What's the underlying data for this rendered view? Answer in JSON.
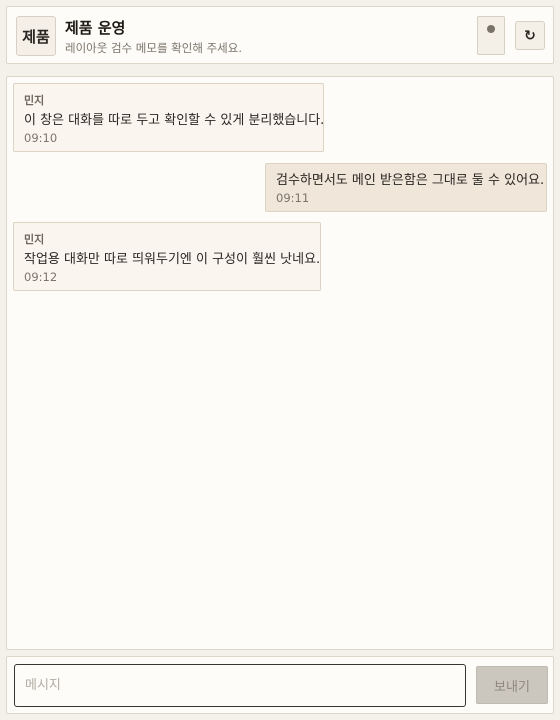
{
  "header": {
    "avatar_text": "제품",
    "title": "제품 운영",
    "subtitle": "레이아웃 검수 메모를 확인해 주세요.",
    "refresh_icon": "↻"
  },
  "messages": [
    {
      "direction": "in",
      "sender": "민지",
      "text": "이 창은 대화를 따로 두고 확인할 수 있게 분리했습니다.",
      "time": "09:10"
    },
    {
      "direction": "out",
      "sender": "",
      "text": "검수하면서도 메인 받은함은 그대로 둘 수 있어요.",
      "time": "09:11"
    },
    {
      "direction": "in",
      "sender": "민지",
      "text": "작업용 대화만 따로 띄워두기엔 이 구성이 훨씬 낫네요.",
      "time": "09:12"
    }
  ],
  "composer": {
    "placeholder": "메시지",
    "send_label": "보내기"
  }
}
